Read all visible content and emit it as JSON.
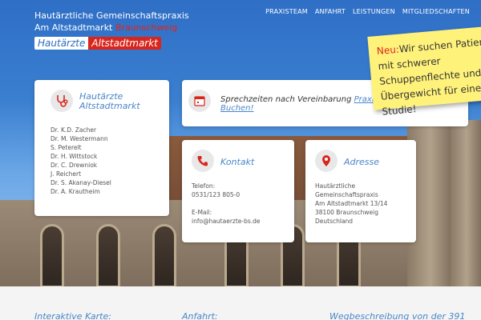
{
  "header": {
    "title_line1": "Hautärztliche Gemeinschaftspraxis",
    "title_line2_a": "Am Altstadtmarkt",
    "title_line2_b": "Braunschweig",
    "logo_part1": "Hautärzte",
    "logo_part2": "Altstadtmarkt"
  },
  "nav": {
    "items": [
      "PRAXISTEAM",
      "ANFAHRT",
      "LEISTUNGEN",
      "MITGLIEDSCHAFTEN"
    ]
  },
  "sticky_note": {
    "prefix": "Neu:",
    "text": "Wir suchen Patienten mit schwerer Schuppenflechte und Übergewicht für eine Studie!"
  },
  "doctors_card": {
    "title_line1": "Hautärzte",
    "title_line2": "Altstadtmarkt",
    "doctors": [
      "Dr. K.D. Zacher",
      "Dr. M. Westermann",
      "S. Peterelt",
      "Dr. H. Wittstock",
      "Dr. C. Drewniok",
      "J. Reichert",
      "Dr. S. Akanay-Diesel",
      "Dr. A. Krautheim"
    ]
  },
  "hours_card": {
    "text": "Sprechzeiten nach Vereinbarung",
    "link_line1": "Praxistermin online",
    "link_line2": "Buchen!"
  },
  "contact_card": {
    "title": "Kontakt",
    "phone_label": "Telefon:",
    "phone": "0531/123 805-0",
    "email_label": "E-Mail:",
    "email": "info@hautaerzte-bs.de"
  },
  "address_card": {
    "title": "Adresse",
    "lines": [
      "Hautärztliche",
      "Gemeinschaftspraxis",
      "Am Altstadtmarkt 13/14",
      "38100 Braunschweig",
      "Deutschland"
    ]
  },
  "bottom": {
    "col1": "Interaktive Karte:",
    "col2": "Anfahrt:",
    "col3": "Wegbeschreibung von der 391"
  },
  "colors": {
    "accent_blue": "#4a86c8",
    "brand_red": "#d9261c",
    "note_yellow": "#fff27a"
  }
}
